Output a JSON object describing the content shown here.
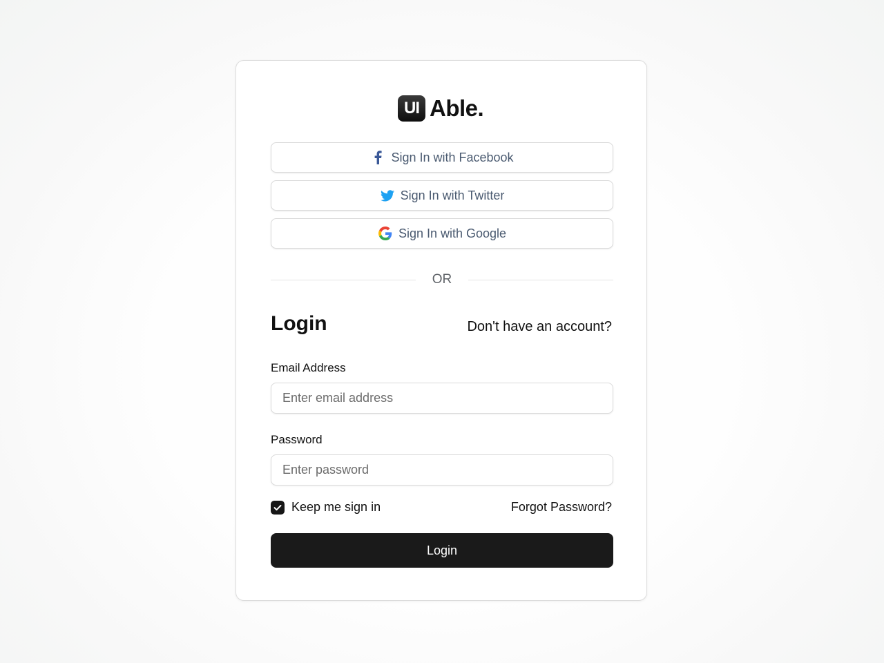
{
  "brand": {
    "mark_text": "UI",
    "name": "Able."
  },
  "social": [
    {
      "label": "Sign In with Facebook",
      "icon": "facebook-icon",
      "color": "#3b5998"
    },
    {
      "label": "Sign In with Twitter",
      "icon": "twitter-icon",
      "color": "#1da1f2"
    },
    {
      "label": "Sign In with Google",
      "icon": "google-icon",
      "color": "#4285f4"
    }
  ],
  "divider": {
    "text": "OR"
  },
  "login": {
    "title": "Login",
    "signup_link": "Don't have an account?",
    "email": {
      "label": "Email Address",
      "placeholder": "Enter email address",
      "value": ""
    },
    "password": {
      "label": "Password",
      "placeholder": "Enter password",
      "value": ""
    },
    "keep_signed_in": {
      "label": "Keep me sign in",
      "checked": true
    },
    "forgot_link": "Forgot Password?",
    "submit_label": "Login"
  },
  "colors": {
    "primary": "#1a1a1a",
    "social_text": "#4a5a70"
  }
}
